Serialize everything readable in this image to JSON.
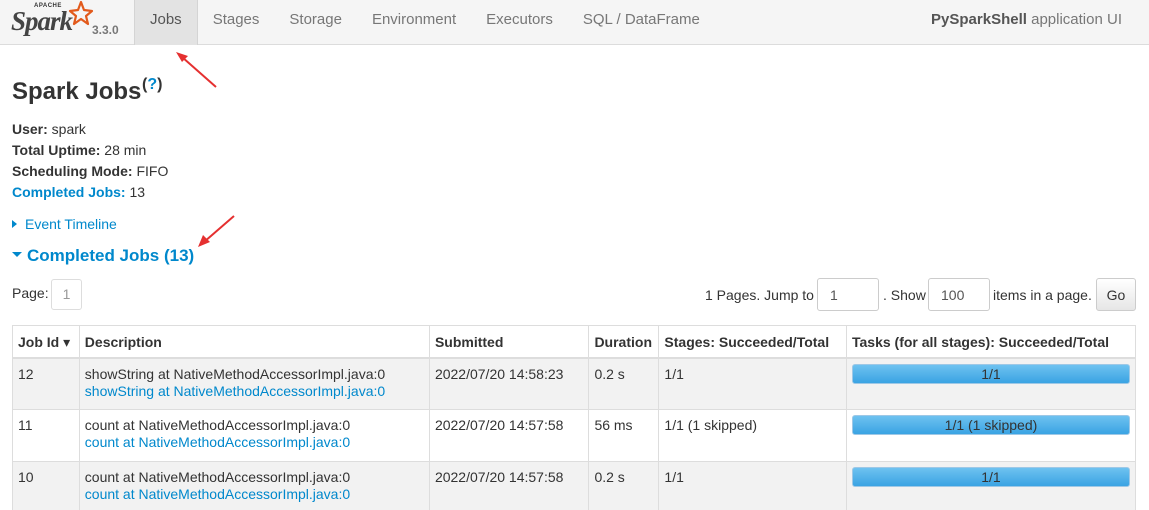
{
  "brand": {
    "apache": "APACHE",
    "spark": "Spark",
    "version": "3.3.0"
  },
  "nav": {
    "tabs": [
      {
        "label": "Jobs",
        "active": true
      },
      {
        "label": "Stages"
      },
      {
        "label": "Storage"
      },
      {
        "label": "Environment"
      },
      {
        "label": "Executors"
      },
      {
        "label": "SQL / DataFrame"
      }
    ],
    "app_name": "PySparkShell",
    "app_suffix": " application UI"
  },
  "page": {
    "title": "Spark Jobs",
    "help": "?"
  },
  "summary": {
    "user_label": "User:",
    "user_value": " spark",
    "uptime_label": "Total Uptime:",
    "uptime_value": " 28 min",
    "mode_label": "Scheduling Mode:",
    "mode_value": " FIFO",
    "completed_label": "Completed Jobs:",
    "completed_value": " 13"
  },
  "timeline": {
    "label": "Event Timeline"
  },
  "completed_section": {
    "label": "Completed Jobs (13)"
  },
  "pager": {
    "page_label": "Page:",
    "current_page": "1",
    "pages_text": "1 Pages. Jump to",
    "jump_value": "1",
    "show_text": ". Show",
    "size_value": "100",
    "items_text": "items in a page.",
    "go_label": "Go"
  },
  "table": {
    "headers": [
      "Job Id ▾",
      "Description",
      "Submitted",
      "Duration",
      "Stages: Succeeded/Total",
      "Tasks (for all stages): Succeeded/Total"
    ],
    "rows": [
      {
        "id": "12",
        "desc": "showString at NativeMethodAccessorImpl.java:0",
        "desc_link": "showString at NativeMethodAccessorImpl.java:0",
        "submitted": "2022/07/20 14:58:23",
        "duration": "0.2 s",
        "stages": "1/1",
        "tasks": "1/1",
        "tasks_fraction": 1.0
      },
      {
        "id": "11",
        "desc": "count at NativeMethodAccessorImpl.java:0",
        "desc_link": "count at NativeMethodAccessorImpl.java:0",
        "submitted": "2022/07/20 14:57:58",
        "duration": "56 ms",
        "stages": "1/1 (1 skipped)",
        "tasks": "1/1 (1 skipped)",
        "tasks_fraction": 1.0
      },
      {
        "id": "10",
        "desc": "count at NativeMethodAccessorImpl.java:0",
        "desc_link": "count at NativeMethodAccessorImpl.java:0",
        "submitted": "2022/07/20 14:57:58",
        "duration": "0.2 s",
        "stages": "1/1",
        "tasks": "1/1",
        "tasks_fraction": 1.0
      }
    ]
  },
  "colors": {
    "link": "#0088cc",
    "progress": "#3aa3e3",
    "annotation_arrow": "#e53030"
  }
}
